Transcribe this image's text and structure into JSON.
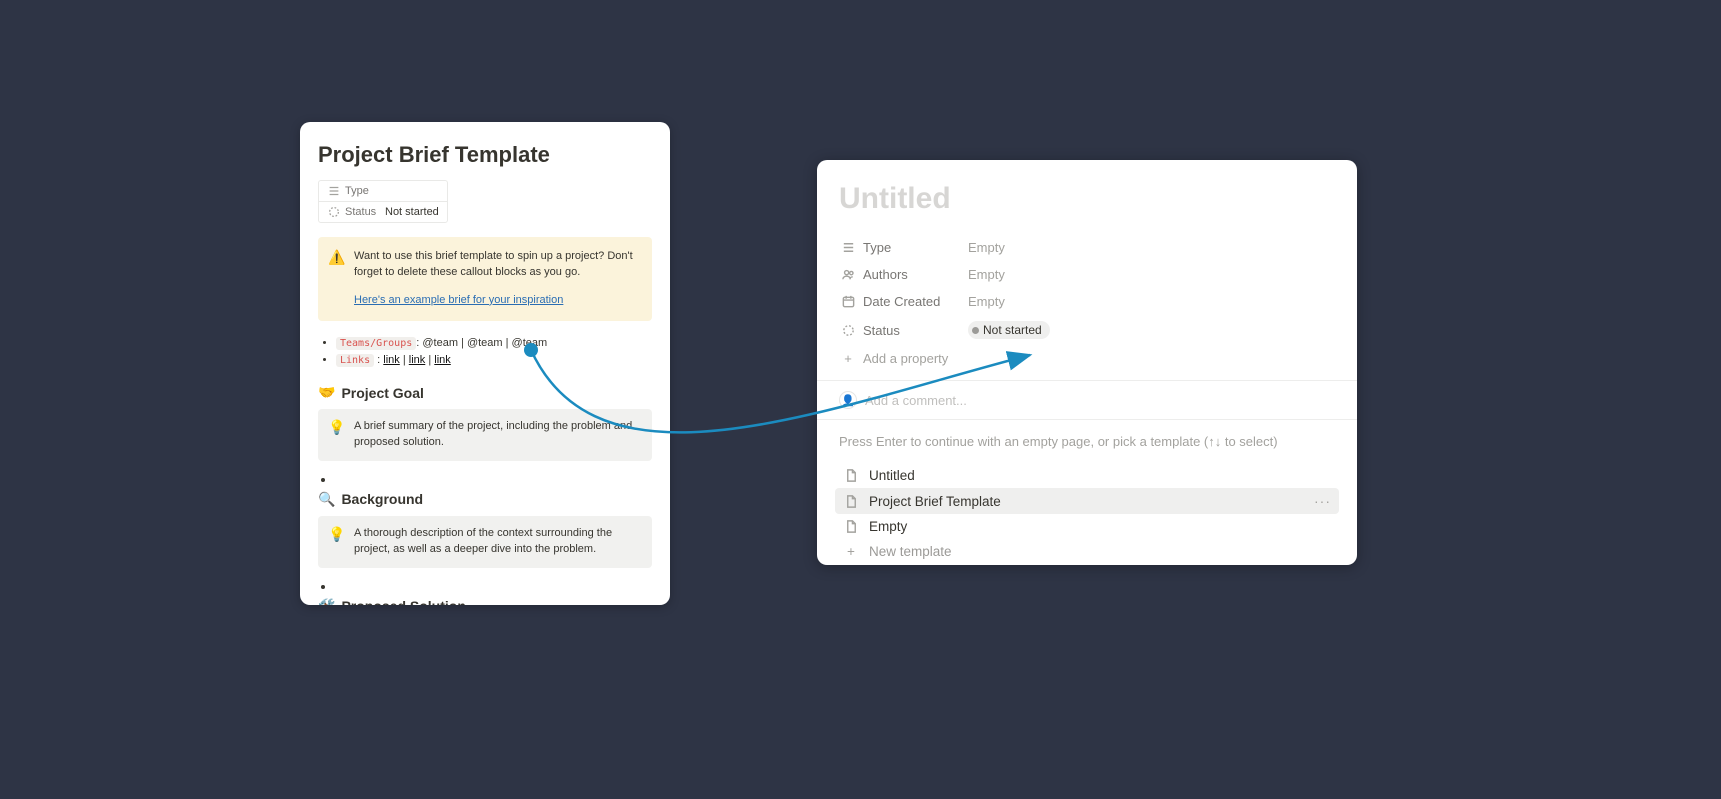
{
  "left": {
    "title": "Project Brief Template",
    "props": {
      "type_label": "Type",
      "status_label": "Status",
      "status_value": "Not started"
    },
    "callout_warn": {
      "text": "Want to use this brief template to spin up a project? Don't forget to delete these callout blocks as you go.",
      "link_text": "Here's an example brief for your inspiration"
    },
    "bullets": {
      "teams_chip": "Teams/Groups",
      "teams_rest": ": @team | @team | @team",
      "links_chip": "Links",
      "links_sep": " : ",
      "link_label": "link"
    },
    "section_goal": {
      "heading": "Project Goal",
      "idea": "A brief summary of the project, including the problem and proposed solution."
    },
    "section_bg": {
      "heading": "Background",
      "idea": "A thorough description of the context surrounding the project, as well as a deeper dive into the problem."
    },
    "section_sol": {
      "heading": "Proposed Solution"
    }
  },
  "right": {
    "title": "Untitled",
    "props": {
      "type": {
        "label": "Type",
        "value": "Empty"
      },
      "authors": {
        "label": "Authors",
        "value": "Empty"
      },
      "date_created": {
        "label": "Date Created",
        "value": "Empty"
      },
      "status": {
        "label": "Status",
        "value": "Not started"
      }
    },
    "add_property": "Add a property",
    "comment_placeholder": "Add a comment...",
    "hint": "Press Enter to continue with an empty page, or pick a template (↑↓ to select)",
    "templates": {
      "untitled": "Untitled",
      "project_brief": "Project Brief Template",
      "empty": "Empty",
      "new": "New template"
    }
  }
}
